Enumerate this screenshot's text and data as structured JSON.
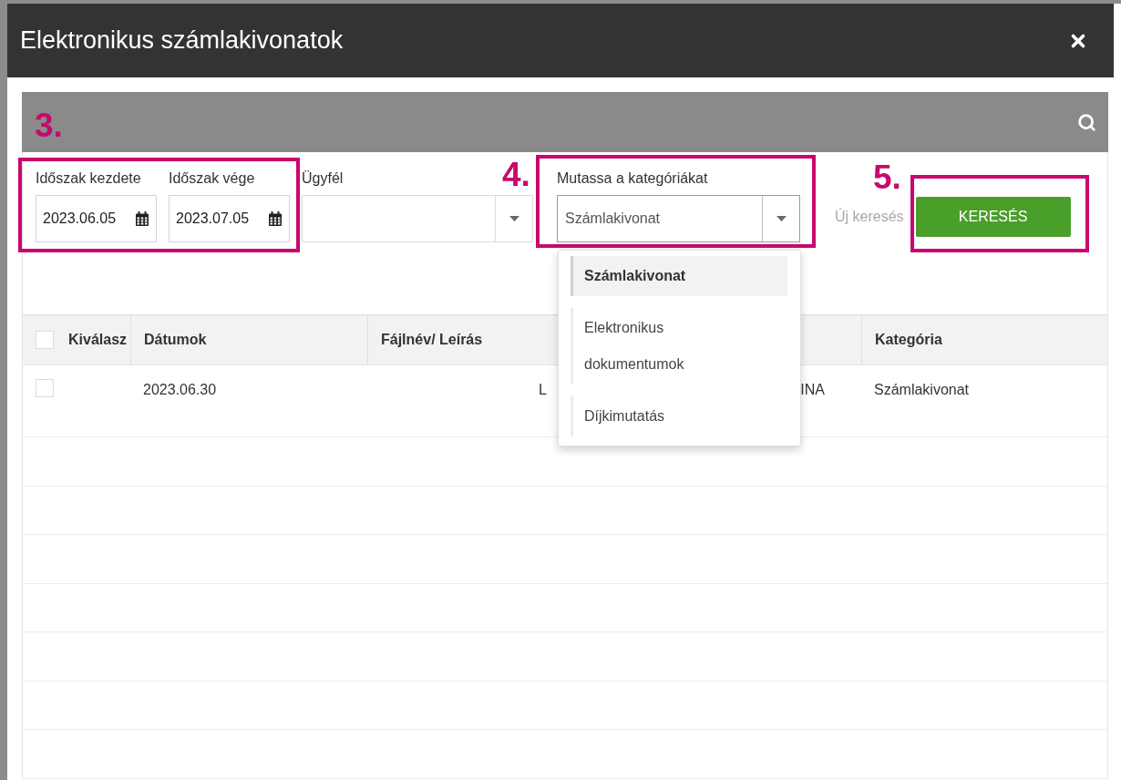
{
  "window": {
    "title": "Elektronikus számlakivonatok"
  },
  "filters": {
    "period_start": {
      "label": "Időszak kezdete",
      "value": "2023.06.05"
    },
    "period_end": {
      "label": "Időszak vége",
      "value": "2023.07.05"
    },
    "client": {
      "label": "Ügyfél"
    },
    "categories": {
      "label": "Mutassa a kategóriákat",
      "value": "Számlakivonat",
      "expanded": true,
      "options": [
        {
          "label": "Számlakivonat",
          "selected": true
        },
        {
          "label": "Elektronikus dokumentumok",
          "selected": false
        },
        {
          "label": "Díjkimutatás",
          "selected": false
        }
      ]
    },
    "new_search": "Új keresés",
    "search_button": "KERESÉS"
  },
  "table": {
    "select_all_checked": false,
    "columns": {
      "select": "Kiválasz",
      "date": "Dátumok",
      "file": "Fájlnév/ Leírás",
      "category": "Kategória"
    },
    "rows": [
      {
        "checked": false,
        "date": "2023.06.30",
        "file": "L",
        "column_4": "INA",
        "category": "Számlakivonat"
      }
    ]
  },
  "annotations": [
    {
      "label": "3."
    },
    {
      "label": "4."
    },
    {
      "label": "5."
    }
  ]
}
